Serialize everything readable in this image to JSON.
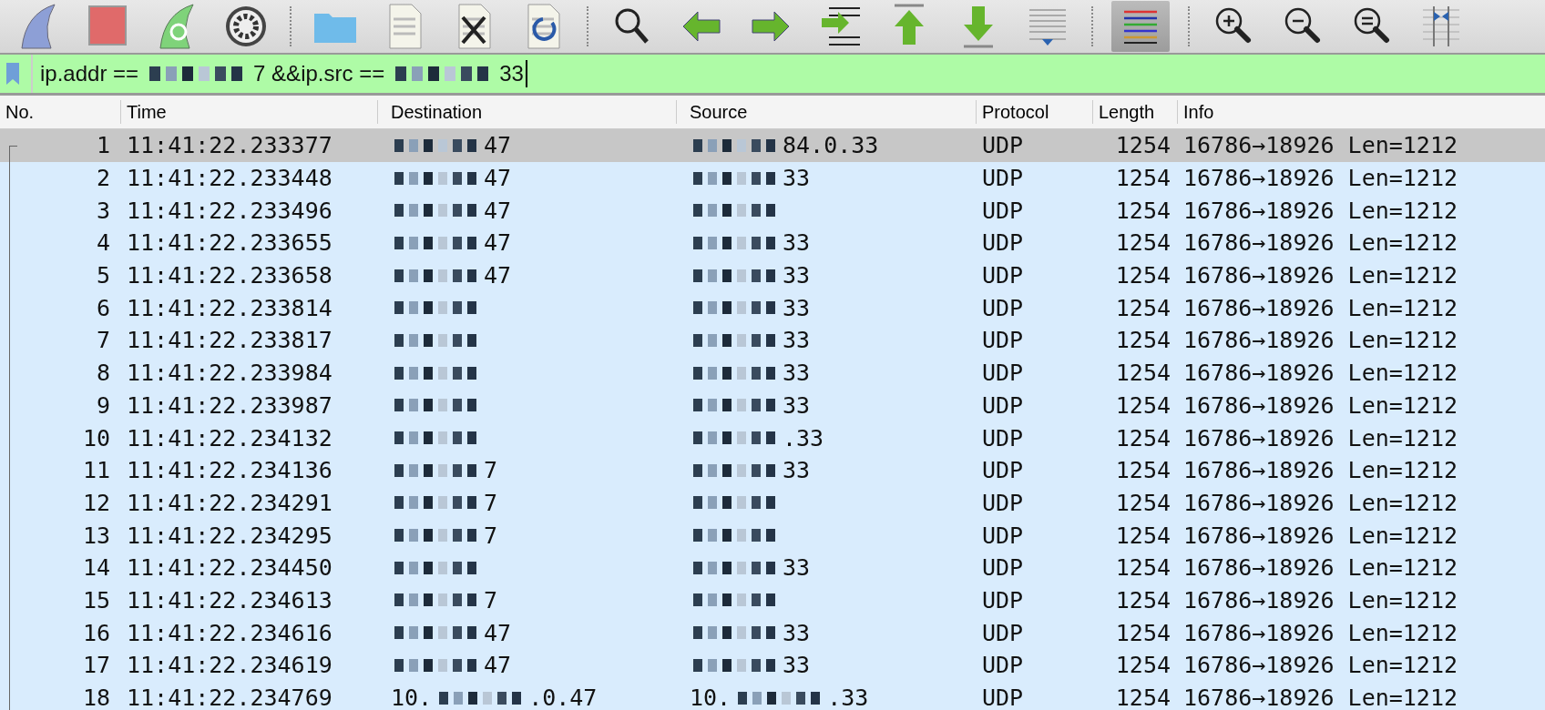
{
  "toolbar": [
    {
      "kind": "fin",
      "pressed": false
    },
    {
      "kind": "stop",
      "pressed": false
    },
    {
      "kind": "fin-restart",
      "pressed": false
    },
    {
      "kind": "gear",
      "pressed": false
    },
    {
      "kind": "sep"
    },
    {
      "kind": "folder",
      "pressed": false
    },
    {
      "kind": "file",
      "pressed": false
    },
    {
      "kind": "file-close",
      "pressed": false
    },
    {
      "kind": "file-reload",
      "pressed": false
    },
    {
      "kind": "sep"
    },
    {
      "kind": "search",
      "pressed": false
    },
    {
      "kind": "back",
      "pressed": false
    },
    {
      "kind": "forward",
      "pressed": false
    },
    {
      "kind": "goto",
      "pressed": false
    },
    {
      "kind": "first",
      "pressed": false
    },
    {
      "kind": "last",
      "pressed": false
    },
    {
      "kind": "autoscroll",
      "pressed": false
    },
    {
      "kind": "sep"
    },
    {
      "kind": "colorize",
      "pressed": true
    },
    {
      "kind": "sep"
    },
    {
      "kind": "zoom-in",
      "pressed": false
    },
    {
      "kind": "zoom-out",
      "pressed": false
    },
    {
      "kind": "zoom-reset",
      "pressed": false
    },
    {
      "kind": "resize",
      "pressed": false
    }
  ],
  "filter": [
    {
      "kind": "text",
      "text": "ip.addr =="
    },
    {
      "kind": "redacted"
    },
    {
      "kind": "text",
      "text": "7 &&ip.src =="
    },
    {
      "kind": "redacted"
    },
    {
      "kind": "text",
      "text": "33"
    }
  ],
  "columns": [
    "No.",
    "Time",
    "Destination",
    "Source",
    "Protocol",
    "Length",
    "Info"
  ],
  "rows": [
    {
      "no": "1",
      "time": "11:41:22.233377",
      "destination": [
        {
          "kind": "redacted"
        },
        {
          "kind": "text",
          "text": "47"
        }
      ],
      "source": [
        {
          "kind": "redacted"
        },
        {
          "kind": "text",
          "text": "84.0.33"
        }
      ],
      "protocol": "UDP",
      "length": "1254",
      "info": "16786→18926 Len=1212",
      "selected": true
    },
    {
      "no": "2",
      "time": "11:41:22.233448",
      "destination": [
        {
          "kind": "redacted"
        },
        {
          "kind": "text",
          "text": "47"
        }
      ],
      "source": [
        {
          "kind": "redacted"
        },
        {
          "kind": "text",
          "text": "33"
        }
      ],
      "protocol": "UDP",
      "length": "1254",
      "info": "16786→18926 Len=1212",
      "selected": false
    },
    {
      "no": "3",
      "time": "11:41:22.233496",
      "destination": [
        {
          "kind": "redacted"
        },
        {
          "kind": "text",
          "text": "47"
        }
      ],
      "source": [
        {
          "kind": "redacted"
        }
      ],
      "protocol": "UDP",
      "length": "1254",
      "info": "16786→18926 Len=1212",
      "selected": false
    },
    {
      "no": "4",
      "time": "11:41:22.233655",
      "destination": [
        {
          "kind": "redacted"
        },
        {
          "kind": "text",
          "text": "47"
        }
      ],
      "source": [
        {
          "kind": "redacted"
        },
        {
          "kind": "text",
          "text": "33"
        }
      ],
      "protocol": "UDP",
      "length": "1254",
      "info": "16786→18926 Len=1212",
      "selected": false
    },
    {
      "no": "5",
      "time": "11:41:22.233658",
      "destination": [
        {
          "kind": "redacted"
        },
        {
          "kind": "text",
          "text": "47"
        }
      ],
      "source": [
        {
          "kind": "redacted"
        },
        {
          "kind": "text",
          "text": "33"
        }
      ],
      "protocol": "UDP",
      "length": "1254",
      "info": "16786→18926 Len=1212",
      "selected": false
    },
    {
      "no": "6",
      "time": "11:41:22.233814",
      "destination": [
        {
          "kind": "redacted"
        }
      ],
      "source": [
        {
          "kind": "redacted"
        },
        {
          "kind": "text",
          "text": "33"
        }
      ],
      "protocol": "UDP",
      "length": "1254",
      "info": "16786→18926 Len=1212",
      "selected": false
    },
    {
      "no": "7",
      "time": "11:41:22.233817",
      "destination": [
        {
          "kind": "redacted"
        }
      ],
      "source": [
        {
          "kind": "redacted"
        },
        {
          "kind": "text",
          "text": "33"
        }
      ],
      "protocol": "UDP",
      "length": "1254",
      "info": "16786→18926 Len=1212",
      "selected": false
    },
    {
      "no": "8",
      "time": "11:41:22.233984",
      "destination": [
        {
          "kind": "redacted"
        }
      ],
      "source": [
        {
          "kind": "redacted"
        },
        {
          "kind": "text",
          "text": "33"
        }
      ],
      "protocol": "UDP",
      "length": "1254",
      "info": "16786→18926 Len=1212",
      "selected": false
    },
    {
      "no": "9",
      "time": "11:41:22.233987",
      "destination": [
        {
          "kind": "redacted"
        }
      ],
      "source": [
        {
          "kind": "redacted"
        },
        {
          "kind": "text",
          "text": "33"
        }
      ],
      "protocol": "UDP",
      "length": "1254",
      "info": "16786→18926 Len=1212",
      "selected": false
    },
    {
      "no": "10",
      "time": "11:41:22.234132",
      "destination": [
        {
          "kind": "redacted"
        }
      ],
      "source": [
        {
          "kind": "redacted"
        },
        {
          "kind": "text",
          "text": ".33"
        }
      ],
      "protocol": "UDP",
      "length": "1254",
      "info": "16786→18926 Len=1212",
      "selected": false
    },
    {
      "no": "11",
      "time": "11:41:22.234136",
      "destination": [
        {
          "kind": "redacted"
        },
        {
          "kind": "text",
          "text": "7"
        }
      ],
      "source": [
        {
          "kind": "redacted"
        },
        {
          "kind": "text",
          "text": "33"
        }
      ],
      "protocol": "UDP",
      "length": "1254",
      "info": "16786→18926 Len=1212",
      "selected": false
    },
    {
      "no": "12",
      "time": "11:41:22.234291",
      "destination": [
        {
          "kind": "redacted"
        },
        {
          "kind": "text",
          "text": "7"
        }
      ],
      "source": [
        {
          "kind": "redacted"
        }
      ],
      "protocol": "UDP",
      "length": "1254",
      "info": "16786→18926 Len=1212",
      "selected": false
    },
    {
      "no": "13",
      "time": "11:41:22.234295",
      "destination": [
        {
          "kind": "redacted"
        },
        {
          "kind": "text",
          "text": "7"
        }
      ],
      "source": [
        {
          "kind": "redacted"
        }
      ],
      "protocol": "UDP",
      "length": "1254",
      "info": "16786→18926 Len=1212",
      "selected": false
    },
    {
      "no": "14",
      "time": "11:41:22.234450",
      "destination": [
        {
          "kind": "redacted"
        }
      ],
      "source": [
        {
          "kind": "redacted"
        },
        {
          "kind": "text",
          "text": "33"
        }
      ],
      "protocol": "UDP",
      "length": "1254",
      "info": "16786→18926 Len=1212",
      "selected": false
    },
    {
      "no": "15",
      "time": "11:41:22.234613",
      "destination": [
        {
          "kind": "redacted"
        },
        {
          "kind": "text",
          "text": "7"
        }
      ],
      "source": [
        {
          "kind": "redacted"
        }
      ],
      "protocol": "UDP",
      "length": "1254",
      "info": "16786→18926 Len=1212",
      "selected": false
    },
    {
      "no": "16",
      "time": "11:41:22.234616",
      "destination": [
        {
          "kind": "redacted"
        },
        {
          "kind": "text",
          "text": "47"
        }
      ],
      "source": [
        {
          "kind": "redacted"
        },
        {
          "kind": "text",
          "text": "33"
        }
      ],
      "protocol": "UDP",
      "length": "1254",
      "info": "16786→18926 Len=1212",
      "selected": false
    },
    {
      "no": "17",
      "time": "11:41:22.234619",
      "destination": [
        {
          "kind": "redacted"
        },
        {
          "kind": "text",
          "text": "47"
        }
      ],
      "source": [
        {
          "kind": "redacted"
        },
        {
          "kind": "text",
          "text": "33"
        }
      ],
      "protocol": "UDP",
      "length": "1254",
      "info": "16786→18926 Len=1212",
      "selected": false
    },
    {
      "no": "18",
      "time": "11:41:22.234769",
      "destination": [
        {
          "kind": "text",
          "text": "10."
        },
        {
          "kind": "redacted"
        },
        {
          "kind": "text",
          "text": ".0.47"
        }
      ],
      "source": [
        {
          "kind": "text",
          "text": "10."
        },
        {
          "kind": "redacted"
        },
        {
          "kind": "text",
          "text": ".33"
        }
      ],
      "protocol": "UDP",
      "length": "1254",
      "info": "16786→18926 Len=1212",
      "selected": false
    }
  ]
}
